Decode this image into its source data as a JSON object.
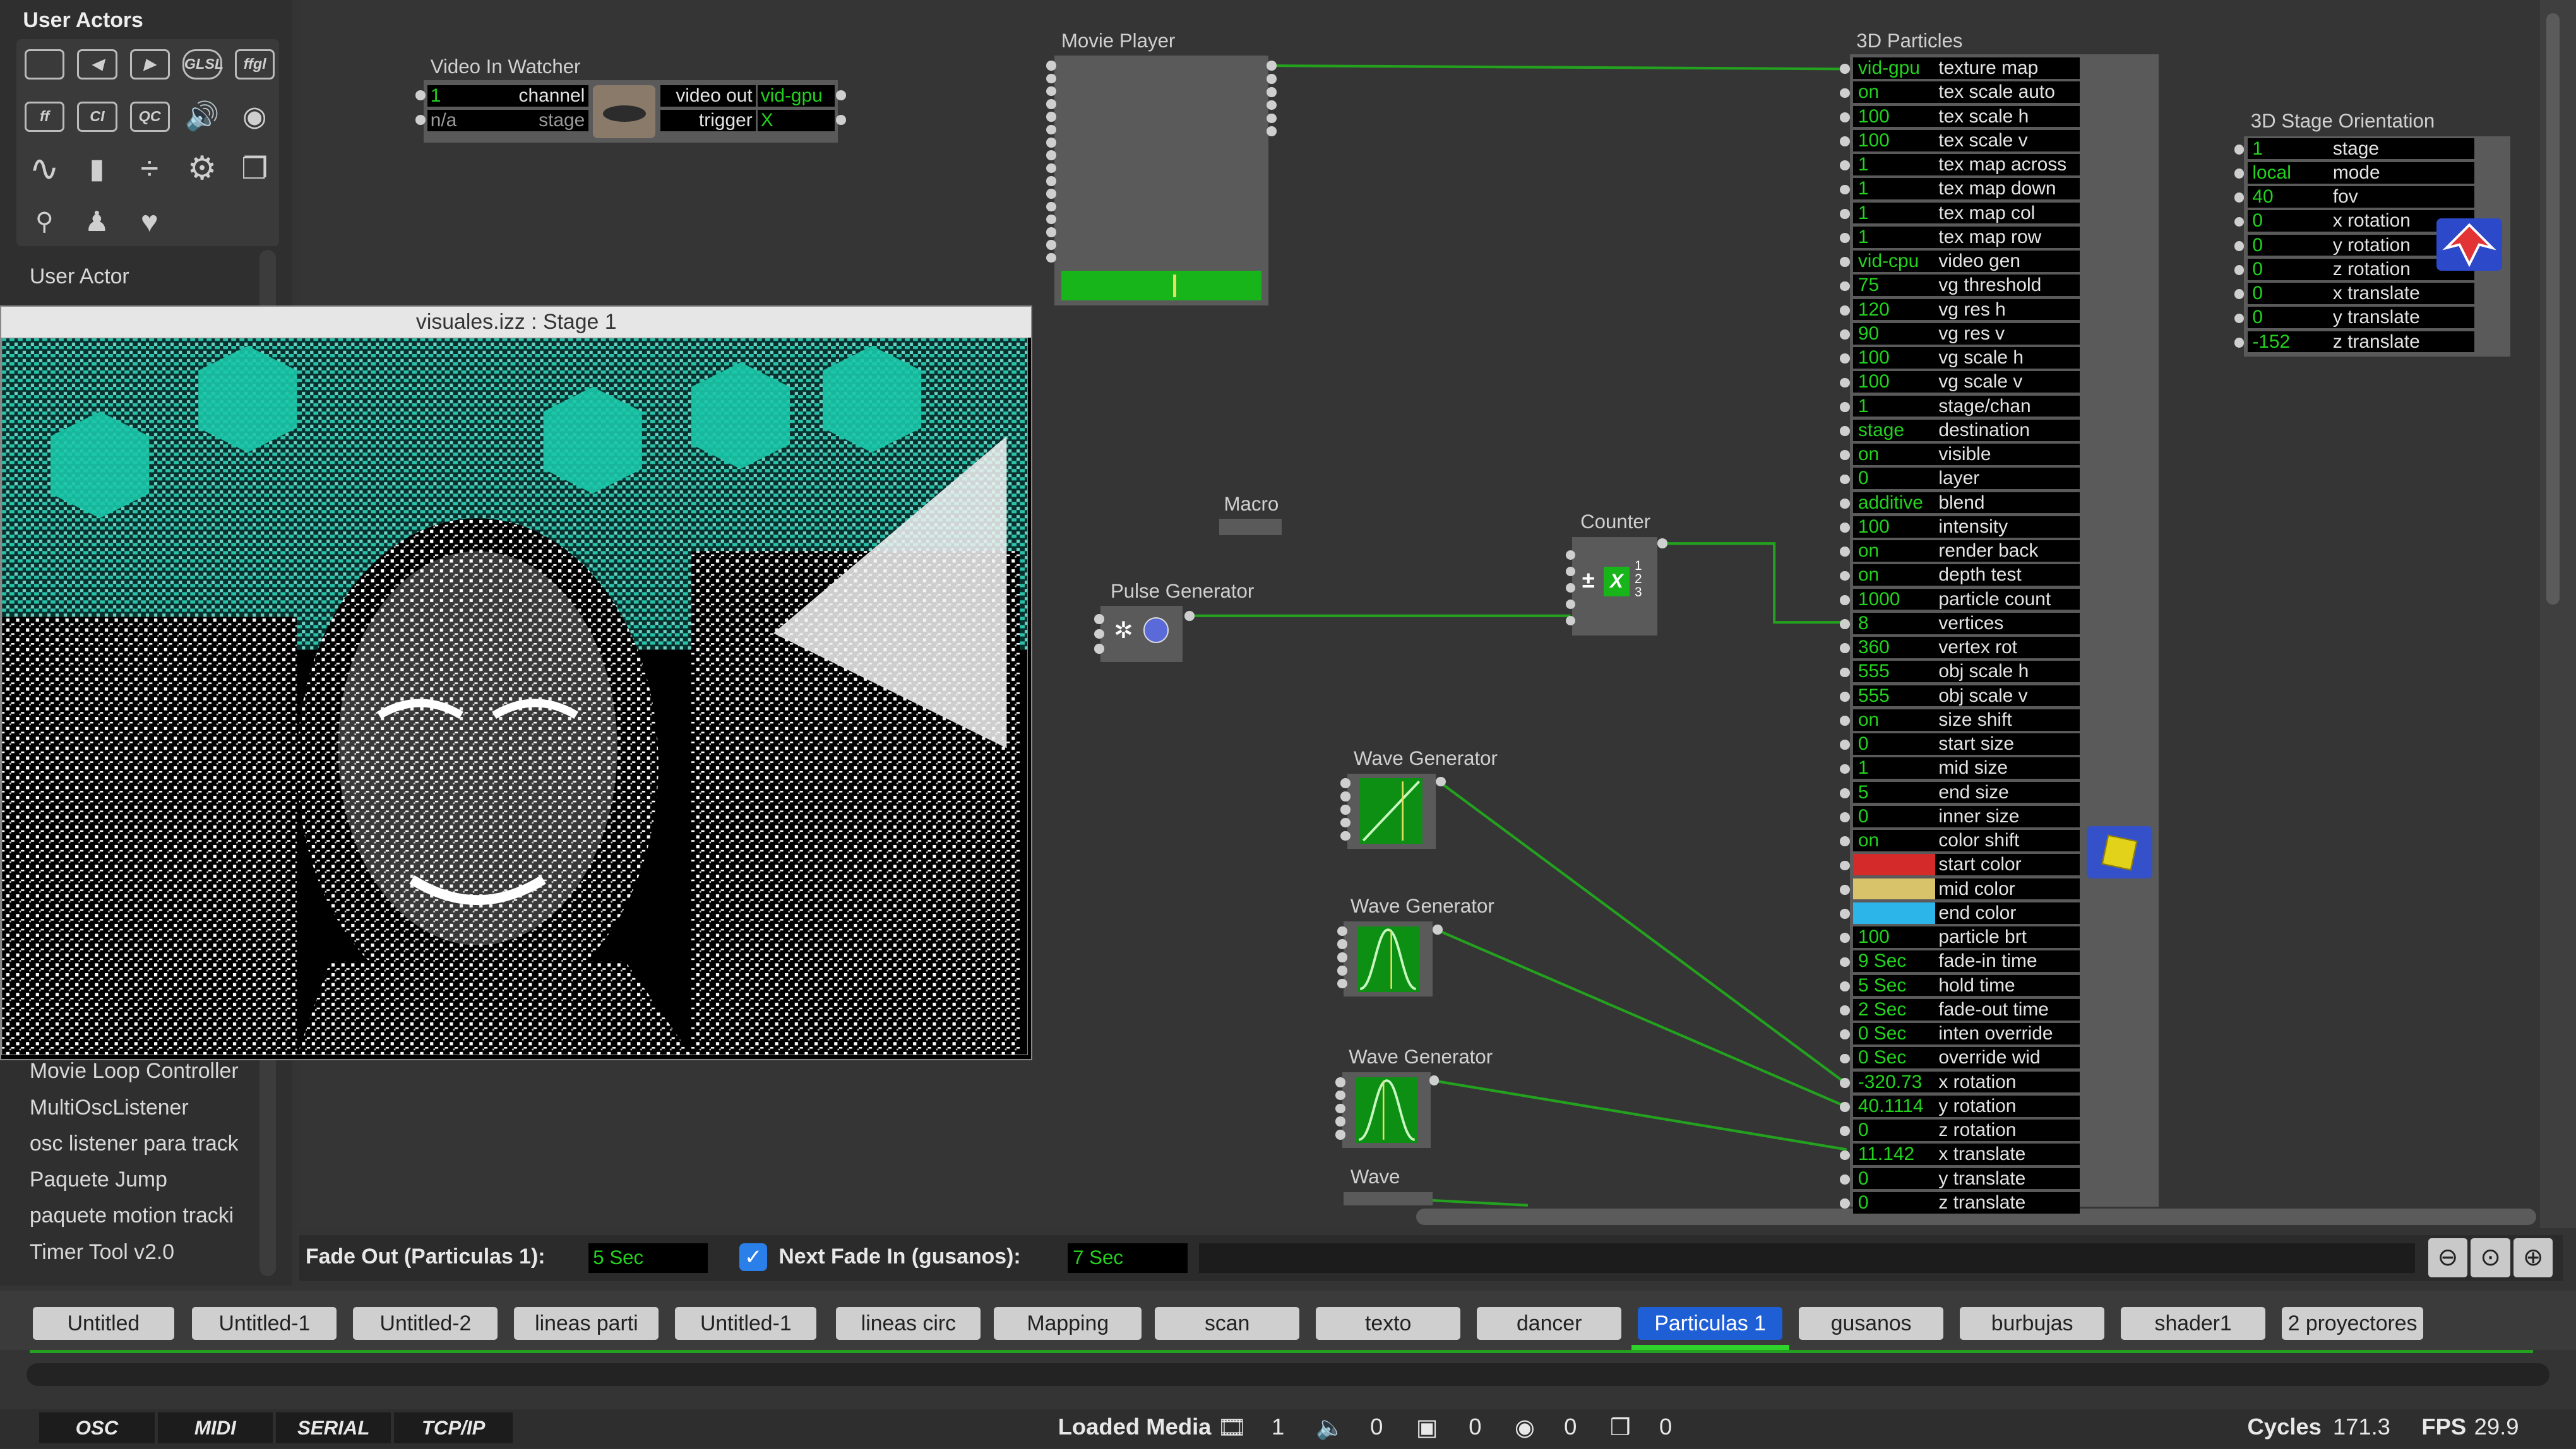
{
  "library": {
    "header": "User Actors",
    "icons": [
      {
        "name": "picture-player-icon",
        "glyph": ""
      },
      {
        "name": "back-icon",
        "glyph": ""
      },
      {
        "name": "forward-icon",
        "glyph": ""
      },
      {
        "name": "glsl-icon",
        "glyph": "GLSL"
      },
      {
        "name": "ffgl-icon",
        "glyph": "ffgl"
      },
      {
        "name": "ff-icon",
        "glyph": "ff"
      },
      {
        "name": "ci-icon",
        "glyph": "CI"
      },
      {
        "name": "qc-icon",
        "glyph": "QC"
      },
      {
        "name": "speaker-icon",
        "glyph": "🔊"
      },
      {
        "name": "palette-icon",
        "glyph": "🎨"
      },
      {
        "name": "wave-icon",
        "glyph": "∿"
      },
      {
        "name": "mouse-icon",
        "glyph": "🖱"
      },
      {
        "name": "divide-icon",
        "glyph": "÷"
      },
      {
        "name": "gear-icon",
        "glyph": "⚙"
      },
      {
        "name": "windows-icon",
        "glyph": "❐"
      },
      {
        "name": "antenna-icon",
        "glyph": "📡"
      },
      {
        "name": "person-icon",
        "glyph": "👤"
      },
      {
        "name": "heart-icon",
        "glyph": "♥"
      }
    ],
    "first_item": "User Actor",
    "items": [
      "Movie Loop Controller",
      "MultiOscListener",
      "osc listener para track",
      "Paquete Jump",
      "paquete motion tracki",
      "Timer Tool v2.0"
    ]
  },
  "stage_window": {
    "title": "visuales.izz : Stage 1"
  },
  "actors": {
    "video_in_watcher": {
      "title": "Video In Watcher",
      "rows": [
        {
          "val": "1",
          "label": "channel",
          "out_label": "video out",
          "out_val": "vid-gpu"
        },
        {
          "val": "n/a",
          "label": "stage",
          "out_label": "trigger",
          "out_val": "X"
        }
      ]
    },
    "movie_player": {
      "title": "Movie Player"
    },
    "macro": {
      "title": "Macro"
    },
    "pulse_generator": {
      "title": "Pulse Generator"
    },
    "counter": {
      "title": "Counter"
    },
    "wave_generators": [
      "Wave Generator",
      "Wave Generator",
      "Wave Generator",
      "Wave"
    ],
    "particles": {
      "title": "3D Particles",
      "rows": [
        {
          "val": "vid-gpu",
          "label": "texture map"
        },
        {
          "val": "on",
          "label": "tex scale auto"
        },
        {
          "val": "100",
          "label": "tex scale h"
        },
        {
          "val": "100",
          "label": "tex scale v"
        },
        {
          "val": "1",
          "label": "tex map across"
        },
        {
          "val": "1",
          "label": "tex map down"
        },
        {
          "val": "1",
          "label": "tex map col"
        },
        {
          "val": "1",
          "label": "tex map row"
        },
        {
          "val": "vid-cpu",
          "label": "video gen"
        },
        {
          "val": "75",
          "label": "vg threshold"
        },
        {
          "val": "120",
          "label": "vg res h"
        },
        {
          "val": "90",
          "label": "vg res v"
        },
        {
          "val": "100",
          "label": "vg scale h"
        },
        {
          "val": "100",
          "label": "vg scale v"
        },
        {
          "val": "1",
          "label": "stage/chan"
        },
        {
          "val": "stage",
          "label": "destination"
        },
        {
          "val": "on",
          "label": "visible"
        },
        {
          "val": "0",
          "label": "layer"
        },
        {
          "val": "additive",
          "label": "blend"
        },
        {
          "val": "100",
          "label": "intensity"
        },
        {
          "val": "on",
          "label": "render back"
        },
        {
          "val": "on",
          "label": "depth test"
        },
        {
          "val": "1000",
          "label": "particle count"
        },
        {
          "val": "8",
          "label": "vertices"
        },
        {
          "val": "360",
          "label": "vertex rot"
        },
        {
          "val": "555",
          "label": "obj scale h"
        },
        {
          "val": "555",
          "label": "obj scale v"
        },
        {
          "val": "on",
          "label": "size shift"
        },
        {
          "val": "0",
          "label": "start size"
        },
        {
          "val": "1",
          "label": "mid size"
        },
        {
          "val": "5",
          "label": "end size"
        },
        {
          "val": "0",
          "label": "inner size"
        },
        {
          "val": "on",
          "label": "color shift"
        },
        {
          "val": "",
          "label": "start color",
          "color": "#d42a2a"
        },
        {
          "val": "",
          "label": "mid color",
          "color": "#d9c36a"
        },
        {
          "val": "",
          "label": "end color",
          "color": "#2bb5e8"
        },
        {
          "val": "100",
          "label": "particle brt"
        },
        {
          "val": "9 Sec",
          "label": "fade-in time"
        },
        {
          "val": "5 Sec",
          "label": "hold time"
        },
        {
          "val": "2 Sec",
          "label": "fade-out time"
        },
        {
          "val": "0 Sec",
          "label": "inten override"
        },
        {
          "val": "0 Sec",
          "label": "override wid"
        },
        {
          "val": "-320.73",
          "label": "x rotation"
        },
        {
          "val": "40.1114",
          "label": "y rotation"
        },
        {
          "val": "0",
          "label": "z rotation"
        },
        {
          "val": "11.142",
          "label": "x translate"
        },
        {
          "val": "0",
          "label": "y translate"
        },
        {
          "val": "0",
          "label": "z translate"
        }
      ]
    },
    "stage_orientation": {
      "title": "3D Stage Orientation",
      "rows": [
        {
          "val": "1",
          "label": "stage"
        },
        {
          "val": "local",
          "label": "mode"
        },
        {
          "val": "40",
          "label": "fov"
        },
        {
          "val": "0",
          "label": "x rotation"
        },
        {
          "val": "0",
          "label": "y rotation"
        },
        {
          "val": "0",
          "label": "z rotation"
        },
        {
          "val": "0",
          "label": "x translate"
        },
        {
          "val": "0",
          "label": "y translate"
        },
        {
          "val": "-152",
          "label": "z translate"
        }
      ]
    }
  },
  "fade_bar": {
    "fade_out_label": "Fade Out (Particulas 1):",
    "fade_out_value": "5 Sec",
    "next_fade_checked": true,
    "next_fade_label": "Next Fade In (gusanos):",
    "next_fade_value": "7 Sec"
  },
  "scene_tabs": [
    "Untitled",
    "Untitled-1",
    "Untitled-2",
    "lineas parti",
    "Untitled-1",
    "lineas circ",
    "Mapping",
    "scan",
    "texto",
    "dancer",
    "Particulas 1",
    "gusanos",
    "burbujas",
    "shader1",
    "2 proyectores"
  ],
  "active_scene": "Particulas 1",
  "status": {
    "buttons": [
      "OSC",
      "MIDI",
      "SERIAL",
      "TCP/IP"
    ],
    "loaded_media_label": "Loaded Media",
    "media_counts": {
      "movies": "1",
      "sounds": "0",
      "pictures": "0",
      "midi": "0",
      "3d": "0"
    },
    "cycles_label": "Cycles",
    "cycles": "171.3",
    "fps_label": "FPS",
    "fps": "29.9"
  },
  "colors": {
    "accent": "#1f5fd6",
    "wire": "#23a11f",
    "value_green": "#23d21f"
  }
}
